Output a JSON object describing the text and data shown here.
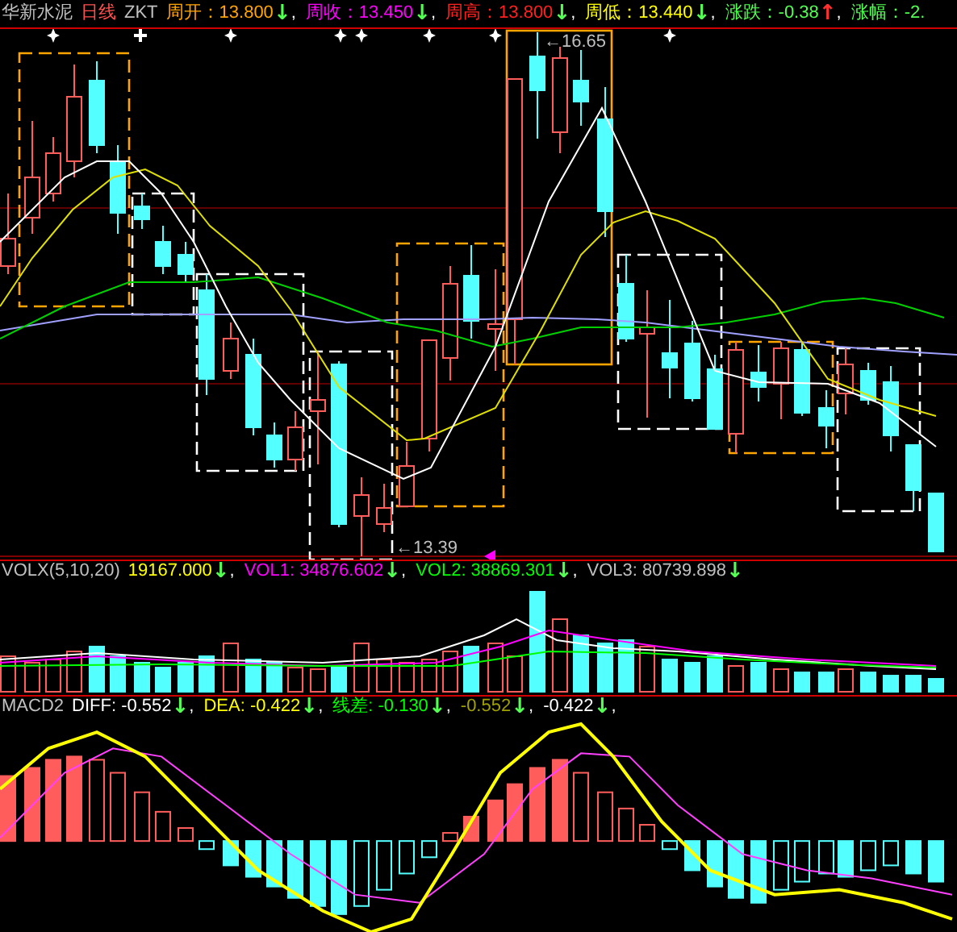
{
  "header": [
    {
      "parts": [
        {
          "kind": "text",
          "text": "华新水泥",
          "color": "#c0c0c0"
        }
      ]
    },
    {
      "parts": [
        {
          "kind": "text",
          "text": "日线",
          "color": "#ff5050"
        }
      ]
    },
    {
      "parts": [
        {
          "kind": "text",
          "text": "ZKT",
          "color": "#c0c0c0"
        }
      ]
    },
    {
      "parts": [
        {
          "kind": "text",
          "text": "周开：13.800",
          "color": "#ffa500"
        },
        {
          "kind": "arrow",
          "text": "↓",
          "color": "#54ff54"
        },
        {
          "kind": "sep",
          "text": ","
        }
      ]
    },
    {
      "parts": [
        {
          "kind": "text",
          "text": "周收：13.450",
          "color": "#ff00ff"
        },
        {
          "kind": "arrow",
          "text": "↓",
          "color": "#54ff54"
        },
        {
          "kind": "sep",
          "text": ","
        }
      ]
    },
    {
      "parts": [
        {
          "kind": "text",
          "text": "周高：13.800",
          "color": "#ff2020"
        },
        {
          "kind": "arrow",
          "text": "↓",
          "color": "#54ff54"
        },
        {
          "kind": "sep",
          "text": ","
        }
      ]
    },
    {
      "parts": [
        {
          "kind": "text",
          "text": "周低：13.440",
          "color": "#ffff00"
        },
        {
          "kind": "arrow",
          "text": "↓",
          "color": "#54ff54"
        },
        {
          "kind": "sep",
          "text": ","
        }
      ]
    },
    {
      "parts": [
        {
          "kind": "text",
          "text": "涨跌：-0.38",
          "color": "#54ff54"
        },
        {
          "kind": "arrow",
          "text": "↑",
          "color": "#ff3030"
        },
        {
          "kind": "sep",
          "text": ","
        }
      ]
    },
    {
      "parts": [
        {
          "kind": "text",
          "text": "涨幅：-2.",
          "color": "#54ff54"
        }
      ]
    }
  ],
  "chart": {
    "high_label": "←16.65",
    "low_label": "←13.39"
  },
  "volume_legend": [
    {
      "parts": [
        {
          "kind": "text",
          "text": "VOLX(5,10,20)",
          "color": "#c0c0c0"
        }
      ]
    },
    {
      "parts": [
        {
          "kind": "text",
          "text": "19167.000",
          "color": "#ffff00"
        },
        {
          "kind": "arrow",
          "text": "↓",
          "color": "#54ff54"
        },
        {
          "kind": "sep",
          "text": ","
        }
      ]
    },
    {
      "parts": [
        {
          "kind": "text",
          "text": "VOL1: 34876.602",
          "color": "#ff00ff"
        },
        {
          "kind": "arrow",
          "text": "↓",
          "color": "#54ff54"
        },
        {
          "kind": "sep",
          "text": ","
        }
      ]
    },
    {
      "parts": [
        {
          "kind": "text",
          "text": "VOL2: 38869.301",
          "color": "#00ff00"
        },
        {
          "kind": "arrow",
          "text": "↓",
          "color": "#54ff54"
        },
        {
          "kind": "sep",
          "text": ","
        }
      ]
    },
    {
      "parts": [
        {
          "kind": "text",
          "text": "VOL3: 80739.898",
          "color": "#c0c0c0"
        },
        {
          "kind": "arrow",
          "text": "↓",
          "color": "#54ff54"
        }
      ]
    }
  ],
  "macd_legend": [
    {
      "parts": [
        {
          "kind": "text",
          "text": "MACD2",
          "color": "#c0c0c0"
        }
      ]
    },
    {
      "parts": [
        {
          "kind": "text",
          "text": "DIFF: -0.552",
          "color": "#ffffff"
        },
        {
          "kind": "arrow",
          "text": "↓",
          "color": "#54ff54"
        },
        {
          "kind": "sep",
          "text": ","
        }
      ]
    },
    {
      "parts": [
        {
          "kind": "text",
          "text": "DEA: -0.422",
          "color": "#ffff00"
        },
        {
          "kind": "arrow",
          "text": "↓",
          "color": "#54ff54"
        },
        {
          "kind": "sep",
          "text": ","
        }
      ]
    },
    {
      "parts": [
        {
          "kind": "text",
          "text": "线差: -0.130",
          "color": "#00ff00"
        },
        {
          "kind": "arrow",
          "text": "↓",
          "color": "#54ff54"
        },
        {
          "kind": "sep",
          "text": ","
        }
      ]
    },
    {
      "parts": [
        {
          "kind": "text",
          "text": "-0.552",
          "color": "#a0a000"
        },
        {
          "kind": "arrow",
          "text": "↓",
          "color": "#54ff54"
        },
        {
          "kind": "sep",
          "text": ","
        }
      ]
    },
    {
      "parts": [
        {
          "kind": "text",
          "text": "-0.422",
          "color": "#ffffff"
        },
        {
          "kind": "arrow",
          "text": "↓",
          "color": "#54ff54"
        },
        {
          "kind": "sep",
          "text": ","
        }
      ]
    }
  ]
}
